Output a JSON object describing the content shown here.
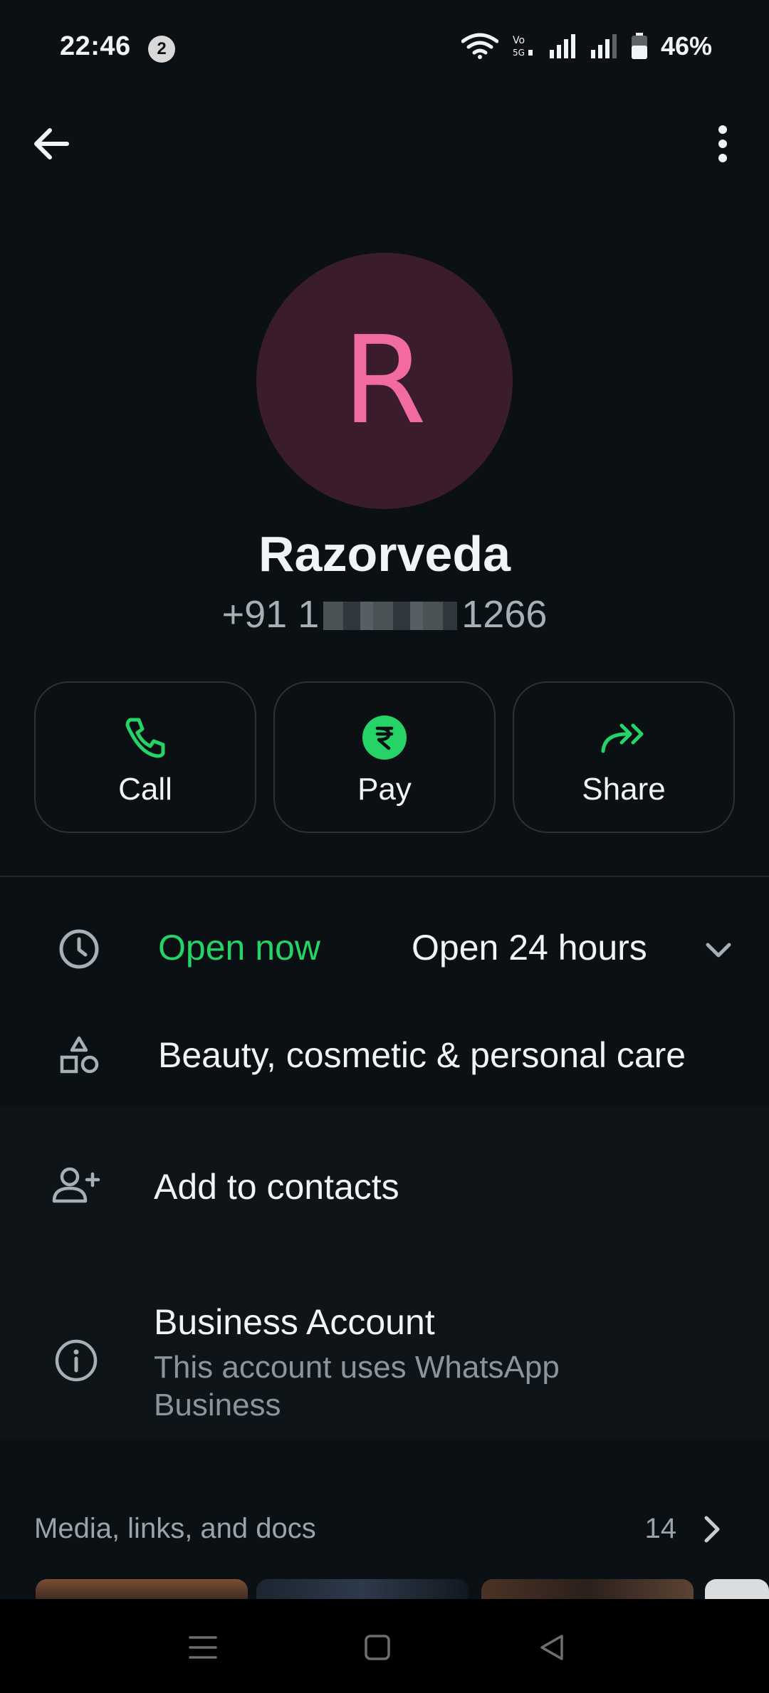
{
  "status_bar": {
    "time": "22:46",
    "notification_count": "2",
    "battery_percent": "46%",
    "icons": [
      "wifi-icon",
      "volte-icon",
      "signal-icon",
      "signal-icon",
      "battery-icon"
    ]
  },
  "top_bar": {
    "back_icon": "arrow-left-icon",
    "menu_icon": "more-vertical-icon"
  },
  "profile": {
    "avatar_letter": "R",
    "name": "Razorveda",
    "phone_prefix": "+91 1",
    "phone_suffix": "1266"
  },
  "actions": [
    {
      "label": "Call",
      "icon": "phone-icon"
    },
    {
      "label": "Pay",
      "icon": "rupee-icon"
    },
    {
      "label": "Share",
      "icon": "share-forward-icon"
    }
  ],
  "hours": {
    "status": "Open now",
    "detail": "Open 24 hours"
  },
  "category": "Beauty, cosmetic & personal care",
  "add_contacts": "Add to contacts",
  "business": {
    "title": "Business Account",
    "subtitle": "This account uses WhatsApp Business"
  },
  "media": {
    "label": "Media, links, and docs",
    "count": "14"
  },
  "colors": {
    "background": "#0b1014",
    "accent_green": "#25d366",
    "avatar_bg": "#3a1c2c",
    "avatar_letter": "#f16aa2"
  }
}
